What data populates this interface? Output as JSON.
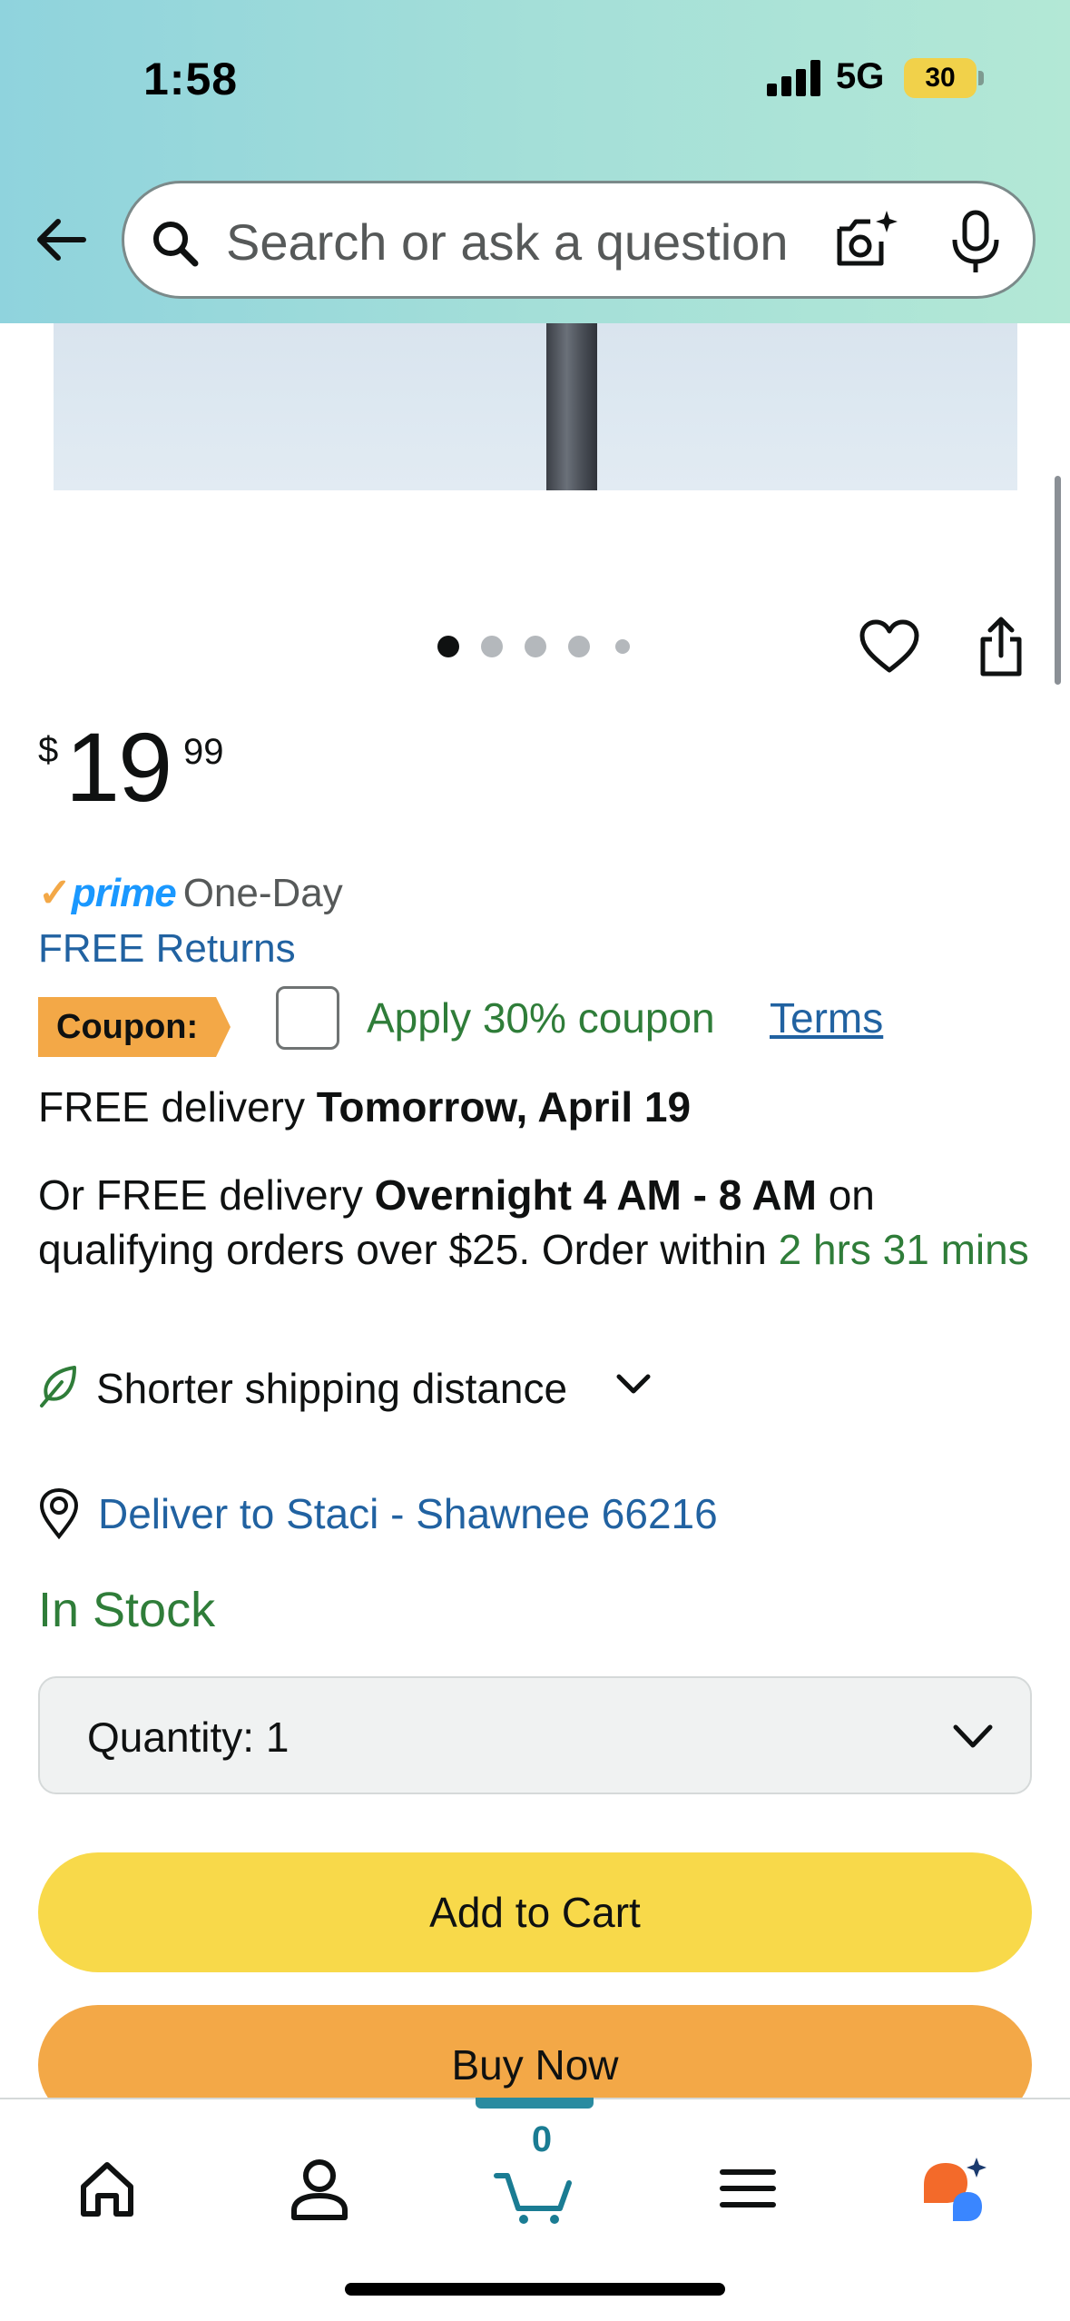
{
  "status_bar": {
    "time": "1:58",
    "network": "5G",
    "battery": "30"
  },
  "search": {
    "placeholder": "Search or ask a question"
  },
  "carousel": {
    "total_dots": 5,
    "active_index": 0
  },
  "price": {
    "currency": "$",
    "whole": "19",
    "fraction": "99"
  },
  "prime": {
    "check": "✓",
    "word": "prime",
    "speed": "One-Day"
  },
  "returns": "FREE Returns",
  "coupon": {
    "tag": "Coupon:",
    "label": "Apply 30% coupon",
    "terms": "Terms",
    "checked": false
  },
  "delivery": {
    "standard_prefix": "FREE delivery ",
    "standard_date": "Tomorrow, April 19",
    "overnight_prefix": "Or FREE delivery ",
    "overnight_window": "Overnight 4 AM - 8 AM",
    "overnight_suffix": " on qualifying orders over $25. Order within ",
    "countdown": "2 hrs 31 mins"
  },
  "shipping_note": "Shorter shipping distance",
  "deliver_to": "Deliver to Staci - Shawnee 66216",
  "availability": "In Stock",
  "quantity": {
    "label": "Quantity:",
    "value": "1"
  },
  "buttons": {
    "add_to_cart": "Add to Cart",
    "buy_now": "Buy Now"
  },
  "nav": {
    "cart_count": "0",
    "active": "cart"
  },
  "colors": {
    "prime_blue": "#1a98ff",
    "link_blue": "#2162a1",
    "stock_green": "#2f7d39",
    "add_cart_yellow": "#f8d94a",
    "buy_now_orange": "#f3a847"
  }
}
